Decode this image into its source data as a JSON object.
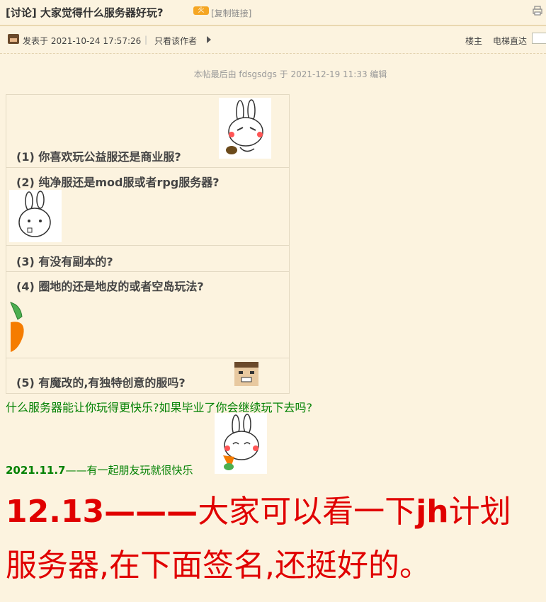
{
  "thread": {
    "title": "[讨论] 大家觉得什么服务器好玩?",
    "badge": "火",
    "copy_link": "[复制链接]"
  },
  "meta": {
    "posted": "发表于 2021-10-24 17:57:26",
    "separator": "|",
    "only_author": "只看该作者",
    "floor": "楼主",
    "elevator": "电梯直达"
  },
  "edited_note": "本帖最后由 fdsgsdgs 于 2021-12-19 11:33 编辑",
  "questions": [
    "(1) 你喜欢玩公益服还是商业服?",
    "(2) 纯净服还是mod服或者rpg服务器?",
    "(3) 有没有副本的?",
    "(4) 圈地的还是地皮的或者空岛玩法?",
    "(5) 有魔改的,有独特创意的服吗?"
  ],
  "green_question": "什么服务器能让你玩得更快乐?如果毕业了你会继续玩下去吗?",
  "update": {
    "date": "2021.11.7",
    "text": "——有一起朋友玩就很快乐"
  },
  "announcement": {
    "prefix": "12.13———",
    "part1": "大家可以看一下",
    "jh": "jh",
    "part2": "计划",
    "line2": "服务器,在下面签名,还挺好的。"
  },
  "colors": {
    "background": "#fcf3df",
    "green": "#008000",
    "red": "#e00000"
  }
}
